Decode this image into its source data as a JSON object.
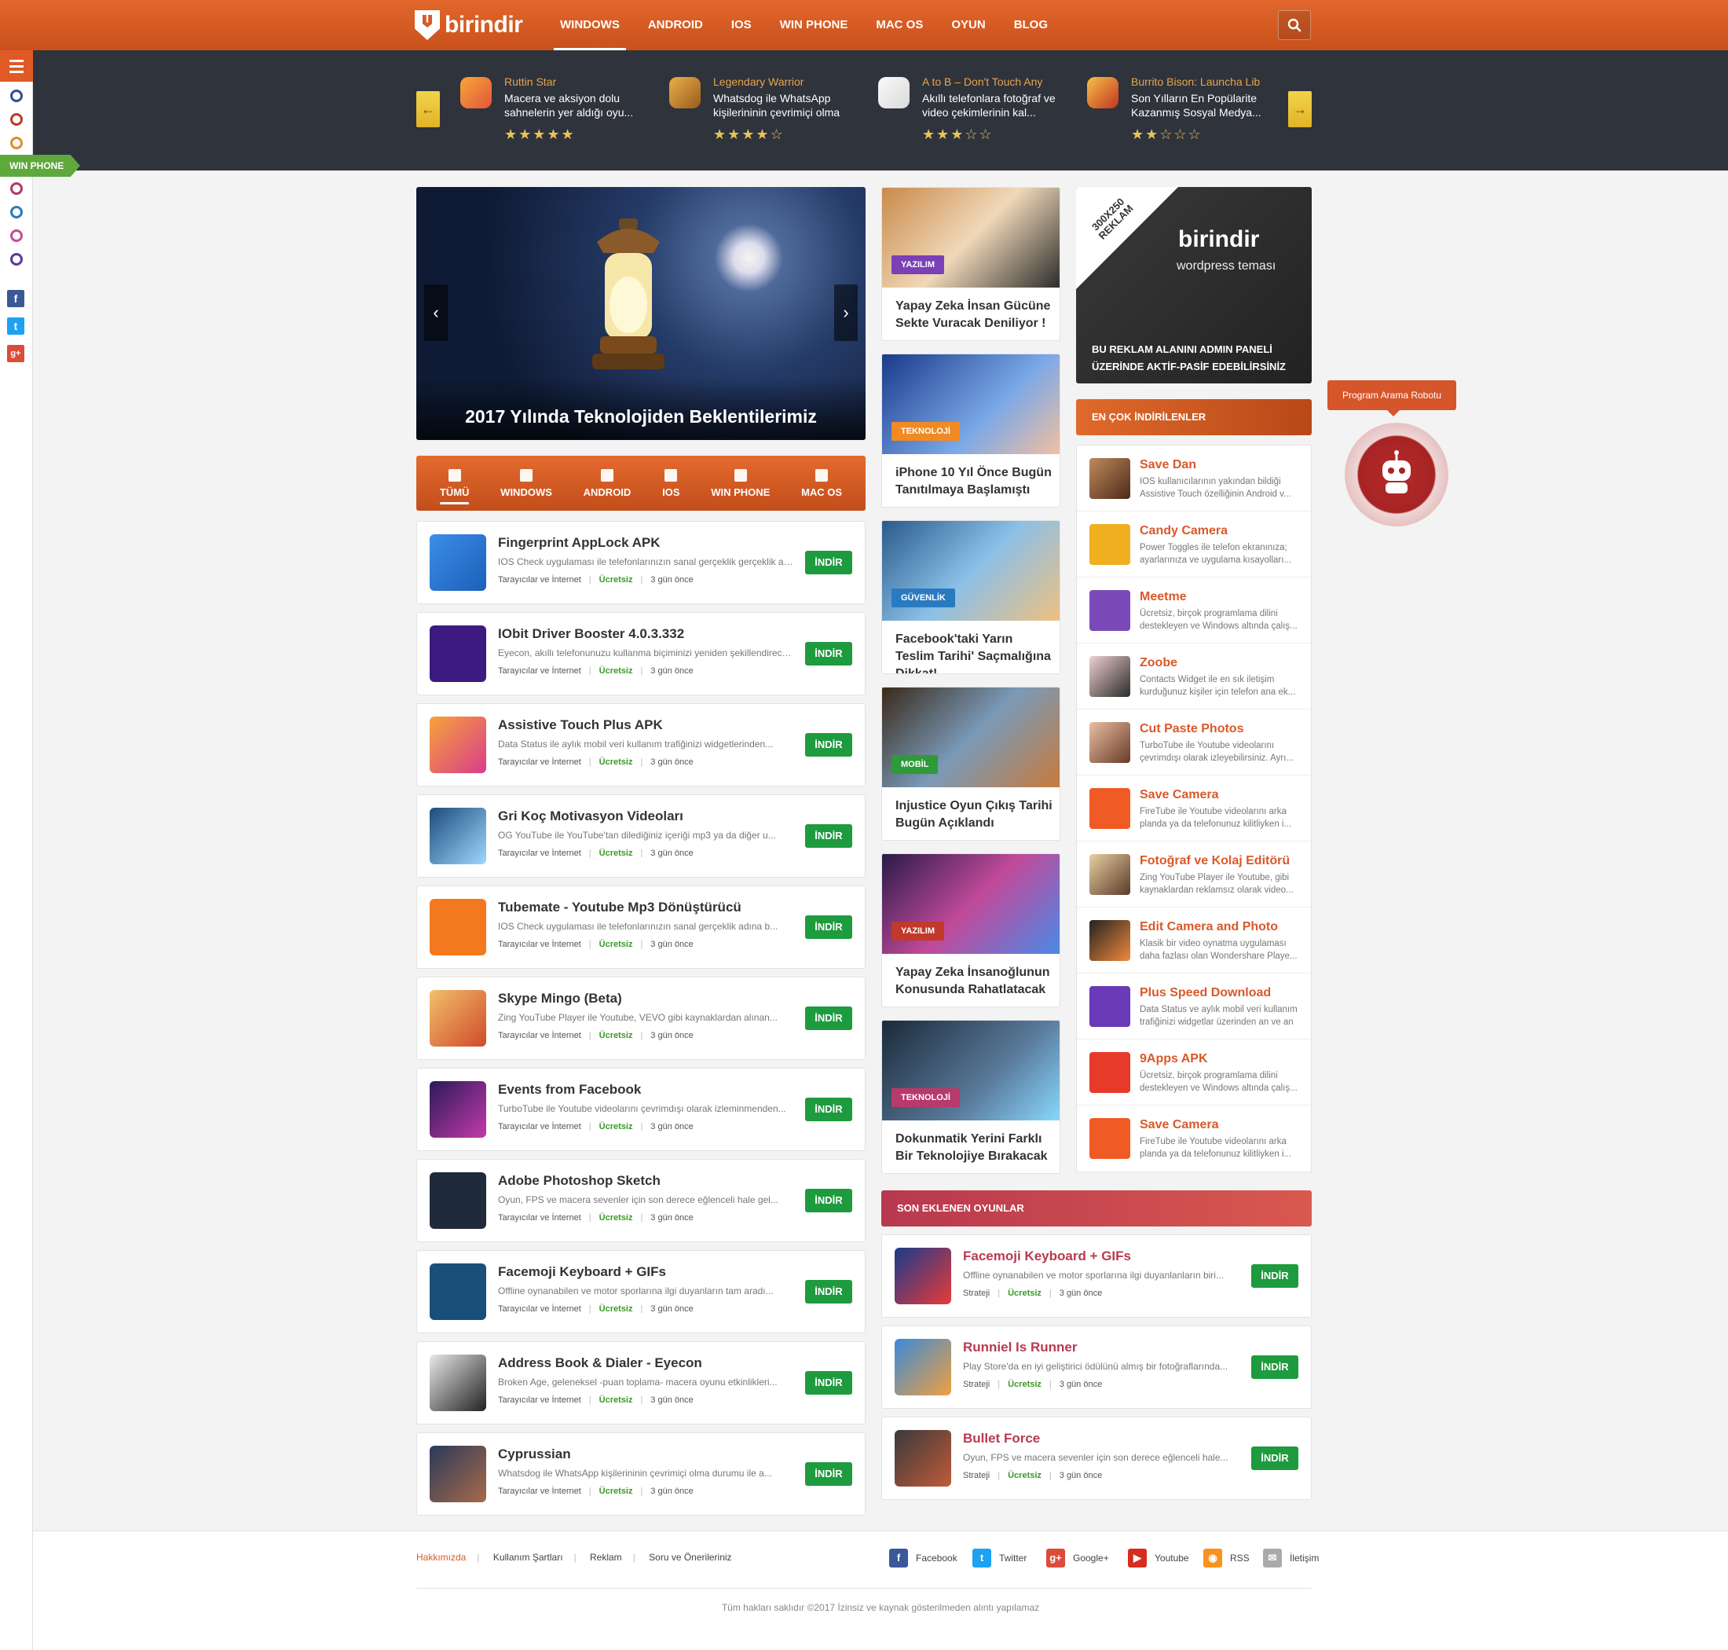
{
  "brand": {
    "name": "birindir",
    "accent": "#d9592a",
    "dark": "#2f333b",
    "green": "#1e9b3e"
  },
  "topnav": {
    "items": [
      "WINDOWS",
      "ANDROID",
      "IOS",
      "WIN PHONE",
      "MAC OS",
      "OYUN",
      "BLOG"
    ],
    "active": "WINDOWS",
    "search_icon": "search-icon"
  },
  "sidebar": {
    "menu_icon": "hamburger-icon",
    "flag": "WIN PHONE",
    "dot_colors": [
      "#3a4a9a",
      "#c0392b",
      "#e08a2c",
      "#b13a6a",
      "#2a7ac0",
      "#c94a9a",
      "#5a3a9a"
    ],
    "social": [
      {
        "icon": "facebook-icon",
        "glyph": "f",
        "color": "#3b5998"
      },
      {
        "icon": "twitter-icon",
        "glyph": "t",
        "color": "#1da1f2"
      },
      {
        "icon": "google-plus-icon",
        "glyph": "g+",
        "color": "#dd4b39"
      }
    ]
  },
  "ticker": {
    "items": [
      {
        "title": "Ruttin Star",
        "desc": "Macera ve aksiyon dolu sahnelerin yer aldığı oyu...",
        "stars": "☆☆☆☆☆"
      },
      {
        "title": "Legendary Warrior",
        "desc": "Whatsdog ile WhatsApp kişilerininin çevrimiçi olma",
        "stars": "☆☆☆☆☆"
      },
      {
        "title": "A to B – Don't Touch Any",
        "desc": "Akıllı telefonlara fotoğraf ve video çekimlerinin kal...",
        "stars": "☆☆☆☆☆"
      },
      {
        "title": "Burrito Bison: Launcha Lib",
        "desc": "Son Yılların En Popülarite Kazanmış Sosyal Medya...",
        "stars": "☆☆☆☆☆"
      }
    ],
    "ratings": [
      5,
      4,
      3,
      2
    ],
    "prev": "←",
    "next": "→"
  },
  "hero": {
    "caption": "2017 Yılında Teknolojiden Beklentilerimiz",
    "prev": "‹",
    "next": "›"
  },
  "tabs": {
    "items": [
      "TÜMÜ",
      "WINDOWS",
      "ANDROID",
      "IOS",
      "WIN PHONE",
      "MAC OS"
    ],
    "active": "TÜMÜ"
  },
  "apps": [
    {
      "title": "Fingerprint AppLock APK",
      "desc": "IOS Check uygulaması ile telefonlarınızın sanal gerçeklik gerçeklik adına b...",
      "category": "Tarayıcılar ve İnternet",
      "license": "Ücretsiz",
      "date": "3 gün önce",
      "button": "İNDİR"
    },
    {
      "title": "IObit Driver Booster 4.0.3.332",
      "desc": "Eyecon, akıllı telefonunuzu kullanma biçiminizi yeniden şekillendirecek...",
      "category": "Tarayıcılar ve İnternet",
      "license": "Ücretsiz",
      "date": "3 gün önce",
      "button": "İNDİR"
    },
    {
      "title": "Assistive Touch Plus APK",
      "desc": "Data Status ile aylık mobil veri kullanım trafiğinizi widgetlerinden...",
      "category": "Tarayıcılar ve İnternet",
      "license": "Ücretsiz",
      "date": "3 gün önce",
      "button": "İNDİR"
    },
    {
      "title": "Gri Koç Motivasyon Videoları",
      "desc": "OG YouTube ile YouTube'tan dilediğiniz içeriği mp3 ya da diğer u...",
      "category": "Tarayıcılar ve İnternet",
      "license": "Ücretsiz",
      "date": "3 gün önce",
      "button": "İNDİR"
    },
    {
      "title": "Tubemate - Youtube Mp3 Dönüştürücü",
      "desc": "IOS Check uygulaması ile telefonlarınızın sanal gerçeklik adına b...",
      "category": "Tarayıcılar ve İnternet",
      "license": "Ücretsiz",
      "date": "3 gün önce",
      "button": "İNDİR"
    },
    {
      "title": "Skype Mingo (Beta)",
      "desc": "Zing YouTube Player ile Youtube, VEVO gibi kaynaklardan alınan...",
      "category": "Tarayıcılar ve İnternet",
      "license": "Ücretsiz",
      "date": "3 gün önce",
      "button": "İNDİR"
    },
    {
      "title": "Events from Facebook",
      "desc": "TurboTube ile Youtube videolarını çevrimdışı olarak izleminmenden...",
      "category": "Tarayıcılar ve İnternet",
      "license": "Ücretsiz",
      "date": "3 gün önce",
      "button": "İNDİR"
    },
    {
      "title": "Adobe Photoshop Sketch",
      "desc": "Oyun, FPS ve macera sevenler için son derece eğlenceli hale gel...",
      "category": "Tarayıcılar ve İnternet",
      "license": "Ücretsiz",
      "date": "3 gün önce",
      "button": "İNDİR"
    },
    {
      "title": "Facemoji Keyboard + GIFs",
      "desc": "Offline oynanabilen ve motor sporlarına ilgi duyanların tam aradı...",
      "category": "Tarayıcılar ve İnternet",
      "license": "Ücretsiz",
      "date": "3 gün önce",
      "button": "İNDİR"
    },
    {
      "title": "Address Book & Dialer - Eyecon",
      "desc": "Broken Age, geleneksel -puan toplama- macera oyunu etkinlikleri...",
      "category": "Tarayıcılar ve İnternet",
      "license": "Ücretsiz",
      "date": "3 gün önce",
      "button": "İNDİR"
    },
    {
      "title": "Cyprussian",
      "desc": "Whatsdog ile WhatsApp kişilerininin çevrimiçi olma durumu ile a...",
      "category": "Tarayıcılar ve İnternet",
      "license": "Ücretsiz",
      "date": "3 gün önce",
      "button": "İNDİR"
    }
  ],
  "news": [
    {
      "badge": "YAZILIM",
      "badge_color": "#7b3fb6",
      "title": "Yapay Zeka İnsan Gücüne Sekte Vuracak Deniliyor !"
    },
    {
      "badge": "TEKNOLOJİ",
      "badge_color": "#f08a24",
      "title": "iPhone 10 Yıl Önce Bugün Tanıtılmaya Başlamıştı"
    },
    {
      "badge": "GÜVENLİK",
      "badge_color": "#2a7ac0",
      "title": "Facebook'taki Yarın Teslim Tarihi' Saçmalığına Dikkat!"
    },
    {
      "badge": "MOBİL",
      "badge_color": "#2e9a3a",
      "title": "Injustice Oyun Çıkış Tarihi Bugün Açıklandı"
    },
    {
      "badge": "YAZILIM",
      "badge_color": "#c0392b",
      "title": "Yapay Zeka İnsanoğlunun Konusunda Rahatlatacak"
    },
    {
      "badge": "TEKNOLOJİ",
      "badge_color": "#b83a6a",
      "title": "Dokunmatik Yerini Farklı Bir Teknolojiye Bırakacak"
    }
  ],
  "ad": {
    "corner": "300X250 REKLAM",
    "logo": "birindir",
    "sub": "wordpress teması",
    "note": "BU REKLAM ALANINI ADMIN PANELİ ÜZERİNDE AKTİF-PASİF EDEBİLİRSİNİZ"
  },
  "most": {
    "heading": "EN ÇOK İNDİRİLENLER",
    "items": [
      {
        "title": "Save Dan",
        "desc": "IOS kullanıcılarının yakından bildiği Assistive Touch özelliğinin Android v..."
      },
      {
        "title": "Candy Camera",
        "desc": "Power Toggles ile telefon ekranınıza; ayarlarınıza ve uygulama kısayolları..."
      },
      {
        "title": "Meetme",
        "desc": "Ücretsiz, birçok programlama dilini destekleyen ve Windows altında çalış..."
      },
      {
        "title": "Zoobe",
        "desc": "Contacts Widget ile en sık iletişim kurduğunuz kişiler için telefon ana ek..."
      },
      {
        "title": "Cut Paste Photos",
        "desc": "TurboTube ile Youtube videolarını çevrimdışı olarak izleyebilirsiniz. Ayrı..."
      },
      {
        "title": "Save Camera",
        "desc": "FireTube ile Youtube videolarını arka planda ya da telefonunuz kilitliyken i..."
      },
      {
        "title": "Fotoğraf ve Kolaj Editörü",
        "desc": "Zing YouTube Player ile Youtube, gibi kaynaklardan reklamsız olarak video..."
      },
      {
        "title": "Edit Camera and Photo",
        "desc": "Klasik bir video oynatma uygulaması daha fazlası olan Wondershare Playe..."
      },
      {
        "title": "Plus Speed Download",
        "desc": "Data Status ve aylık mobil veri kullanım trafiğinizi widgetlar üzerinden an ve an"
      },
      {
        "title": "9Apps APK",
        "desc": "Ücretsiz, birçok programlama dilini destekleyen ve Windows altında çalış..."
      },
      {
        "title": "Save Camera",
        "desc": "FireTube ile Youtube videolarını arka planda ya da telefonunuz kilitliyken i..."
      }
    ]
  },
  "robot": {
    "tooltip": "Program Arama Robotu"
  },
  "games": {
    "heading": "SON EKLENEN OYUNLAR",
    "items": [
      {
        "title": "Facemoji Keyboard + GIFs",
        "desc": "Offline oynanabilen ve motor sporlarına ilgi duyanlanların biri...",
        "category": "Strateji",
        "license": "Ücretsiz",
        "date": "3 gün önce",
        "button": "İNDİR"
      },
      {
        "title": "Runniel Is Runner",
        "desc": "Play Store'da en iyi geliştirici ödülünü almış bir fotoğraflarında...",
        "category": "Strateji",
        "license": "Ücretsiz",
        "date": "3 gün önce",
        "button": "İNDİR"
      },
      {
        "title": "Bullet Force",
        "desc": "Oyun, FPS ve macera sevenler için son derece eğlenceli hale...",
        "category": "Strateji",
        "license": "Ücretsiz",
        "date": "3 gün önce",
        "button": "İNDİR"
      }
    ]
  },
  "footer": {
    "links": [
      "Hakkımızda",
      "Kullanım Şartları",
      "Reklam",
      "Soru ve Önerileriniz"
    ],
    "social": [
      {
        "label": "Facebook",
        "icon": "facebook-icon",
        "glyph": "f",
        "color": "#3b5998"
      },
      {
        "label": "Twitter",
        "icon": "twitter-icon",
        "glyph": "t",
        "color": "#1da1f2"
      },
      {
        "label": "Google+",
        "icon": "google-plus-icon",
        "glyph": "g+",
        "color": "#dd4b39"
      },
      {
        "label": "Youtube",
        "icon": "youtube-icon",
        "glyph": "▶",
        "color": "#d62d20"
      },
      {
        "label": "RSS",
        "icon": "rss-icon",
        "glyph": "◉",
        "color": "#f7931e"
      },
      {
        "label": "İletişim",
        "icon": "mail-icon",
        "glyph": "✉",
        "color": "#aaaaaa"
      }
    ],
    "copyright": "Tüm hakları saklıdır ©2017 İzinsiz ve kaynak gösterilmeden alıntı yapılamaz"
  }
}
